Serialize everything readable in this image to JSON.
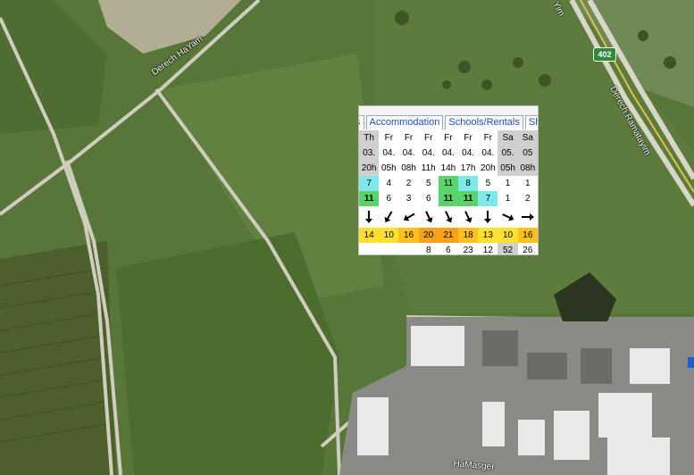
{
  "map": {
    "road_labels": {
      "derech_hayam": "Derech HaYam",
      "derech_ramatayim": "Derech Ramatayim",
      "hamasger": "HaMasger",
      "top_right_fragment": "Yim"
    },
    "highway_shield": "402",
    "colors": {
      "field": "#5d7a3e",
      "road": "#c9c7b8",
      "industrial": "#8a8a86"
    }
  },
  "widget": {
    "tabs": [
      "s",
      "Accommodation",
      "Schools/Rentals",
      "Sho"
    ],
    "columns": [
      {
        "day": "Th",
        "date": "03.",
        "hour": "20h",
        "r1": "7",
        "r2": "11",
        "dir": 180,
        "t": "14",
        "g": ""
      },
      {
        "day": "Fr",
        "date": "04.",
        "hour": "05h",
        "r1": "4",
        "r2": "6",
        "dir": 210,
        "t": "10",
        "g": ""
      },
      {
        "day": "Fr",
        "date": "04.",
        "hour": "08h",
        "r1": "2",
        "r2": "3",
        "dir": 240,
        "t": "16",
        "g": ""
      },
      {
        "day": "Fr",
        "date": "04.",
        "hour": "11h",
        "r1": "5",
        "r2": "6",
        "dir": 155,
        "t": "20",
        "g": "8"
      },
      {
        "day": "Fr",
        "date": "04.",
        "hour": "14h",
        "r1": "11",
        "r2": "11",
        "dir": 155,
        "t": "21",
        "g": "6"
      },
      {
        "day": "Fr",
        "date": "04.",
        "hour": "17h",
        "r1": "8",
        "r2": "11",
        "dir": 155,
        "t": "18",
        "g": "23"
      },
      {
        "day": "Fr",
        "date": "04.",
        "hour": "20h",
        "r1": "5",
        "r2": "7",
        "dir": 180,
        "t": "13",
        "g": "12"
      },
      {
        "day": "Sa",
        "date": "05.",
        "hour": "05h",
        "r1": "1",
        "r2": "1",
        "dir": 115,
        "t": "10",
        "g": "52"
      },
      {
        "day": "Sa",
        "date": "05",
        "hour": "08h",
        "r1": "1",
        "r2": "2",
        "dir": 90,
        "t": "16",
        "g": "26"
      }
    ]
  }
}
